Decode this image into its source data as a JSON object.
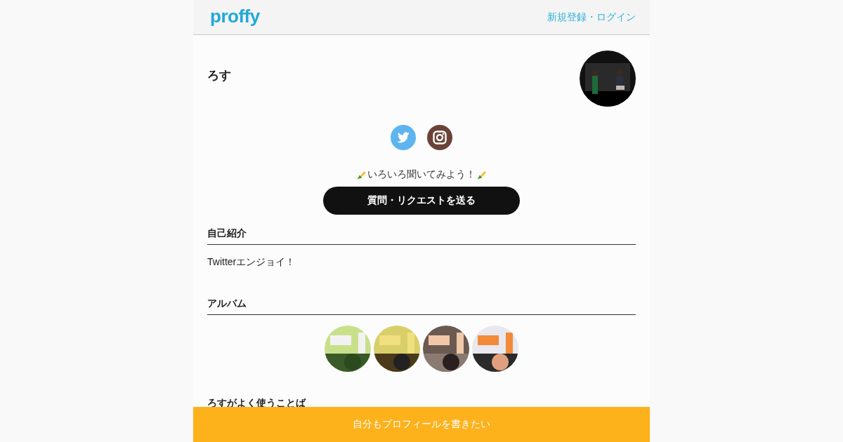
{
  "header": {
    "logo": "proffy",
    "login_link": "新規登録・ログイン"
  },
  "profile": {
    "name": "ろす"
  },
  "social_links": [
    {
      "kind": "twitter"
    },
    {
      "kind": "instagram"
    }
  ],
  "ask": {
    "prompt": "いろいろ聞いてみよう！",
    "button": "質問・リクエストを送る"
  },
  "sections": [
    {
      "kind": "text",
      "title": "自己紹介",
      "body": "Twitterエンジョイ！"
    },
    {
      "kind": "album",
      "title": "アルバム"
    },
    {
      "kind": "heading",
      "title": "ろすがよく使うことば"
    }
  ],
  "footer": {
    "button": "自分もプロフィールを書きたい"
  }
}
